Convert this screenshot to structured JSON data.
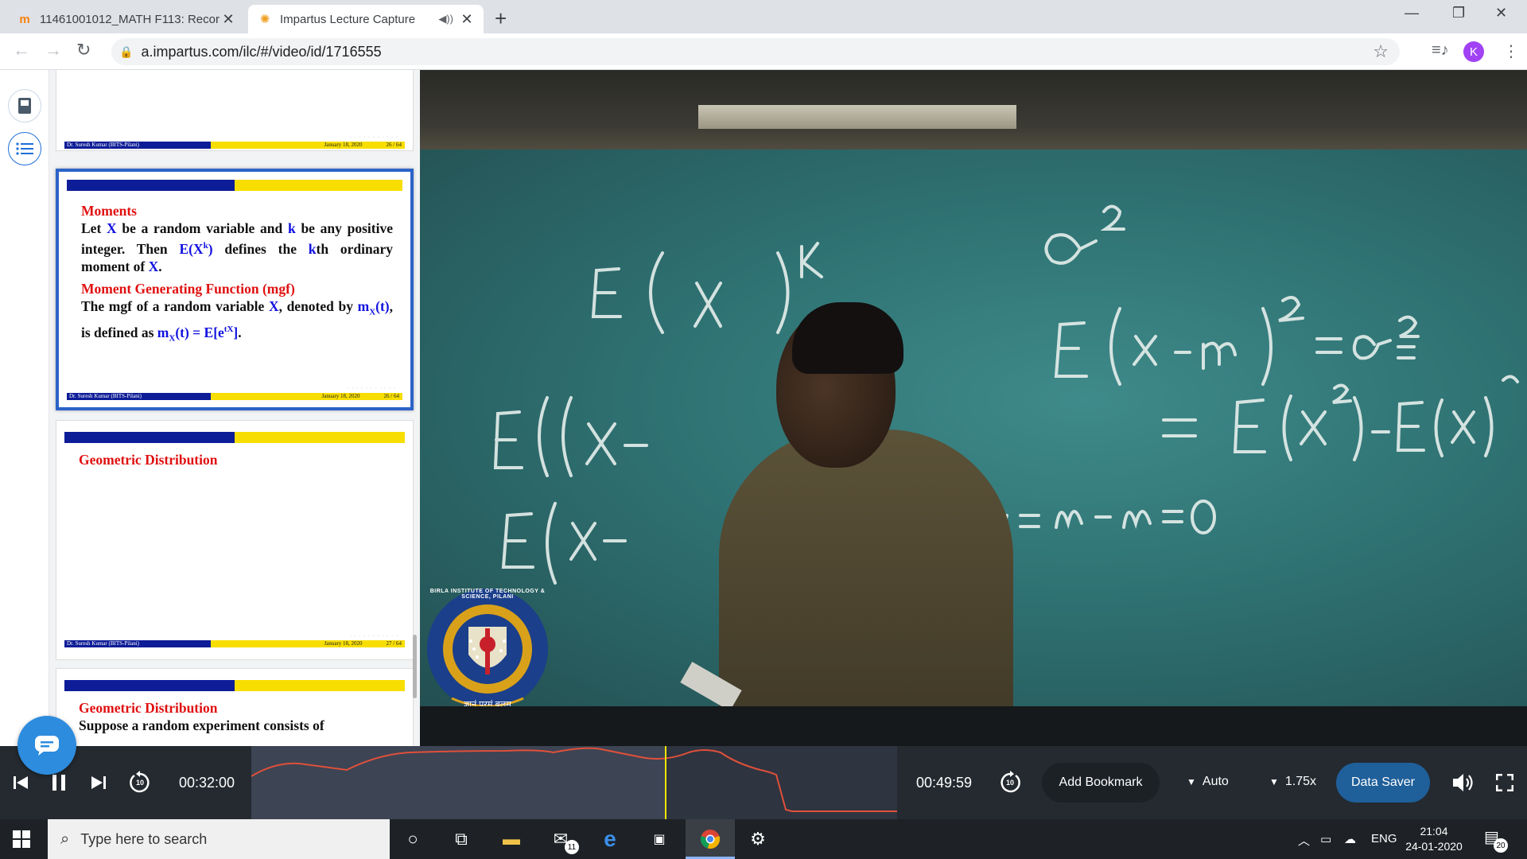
{
  "browser": {
    "tabs": [
      {
        "title": "11461001012_MATH F113: Recor",
        "favicon": "moodle-icon"
      },
      {
        "title": "Impartus Lecture Capture",
        "favicon": "impartus-icon"
      }
    ],
    "url": "a.impartus.com/ilc/#/video/id/1716555",
    "profile_initial": "K"
  },
  "slides": [
    {
      "footer_author": "Dr. Suresh Kumar (BITS-Pilani)",
      "footer_date": "January 18, 2020",
      "footer_page": "26 / 64"
    },
    {
      "heading1": "Moments",
      "p1_a": "Let ",
      "p1_X": "X",
      "p1_b": " be a random variable and ",
      "p1_k": "k",
      "p1_c": " be any positive integer.  Then ",
      "p1_E": "E(X",
      "p1_Esup": "k",
      "p1_Eend": ")",
      "p1_d": " defines the ",
      "p1_k2": "k",
      "p1_e": "th ordinary moment of ",
      "p1_X2": "X",
      "p1_f": ".",
      "heading2": "Moment Generating Function (mgf)",
      "p2_a": "The mgf of a random variable ",
      "p2_X": "X",
      "p2_b": ", denoted by ",
      "p2_m": "m",
      "p2_msub": "X",
      "p2_mend": "(t)",
      "p2_c": ", is defined as ",
      "p2_m2": "m",
      "p2_msub2": "X",
      "p2_mend2": "(t) = E[e",
      "p2_sup": "tX",
      "p2_end": "]",
      "p2_f": ".",
      "footer_author": "Dr. Suresh Kumar (BITS-Pilani)",
      "footer_date": "January 18, 2020",
      "footer_page": "26 / 64"
    },
    {
      "heading1": "Geometric Distribution",
      "footer_author": "Dr. Suresh Kumar (BITS-Pilani)",
      "footer_date": "January 18, 2020",
      "footer_page": "27 / 64"
    },
    {
      "heading1": "Geometric Distribution",
      "text": "Suppose a random experiment consists of"
    }
  ],
  "video": {
    "logo_text": "BIRLA INSTITUTE OF TECHNOLOGY & SCIENCE, PILANI",
    "logo_motto": "ज्ञानं परमं बलम्"
  },
  "player": {
    "current_time": "00:32:00",
    "total_time": "00:49:59",
    "skip_seconds": "10",
    "played_fraction": 0.64,
    "add_bookmark": "Add Bookmark",
    "quality": "Auto",
    "speed": "1.75x",
    "data_saver": "Data Saver"
  },
  "taskbar": {
    "search_placeholder": "Type here to search",
    "mail_badge": "11",
    "language": "ENG",
    "time": "21:04",
    "date": "24-01-2020",
    "notifications": "20"
  }
}
